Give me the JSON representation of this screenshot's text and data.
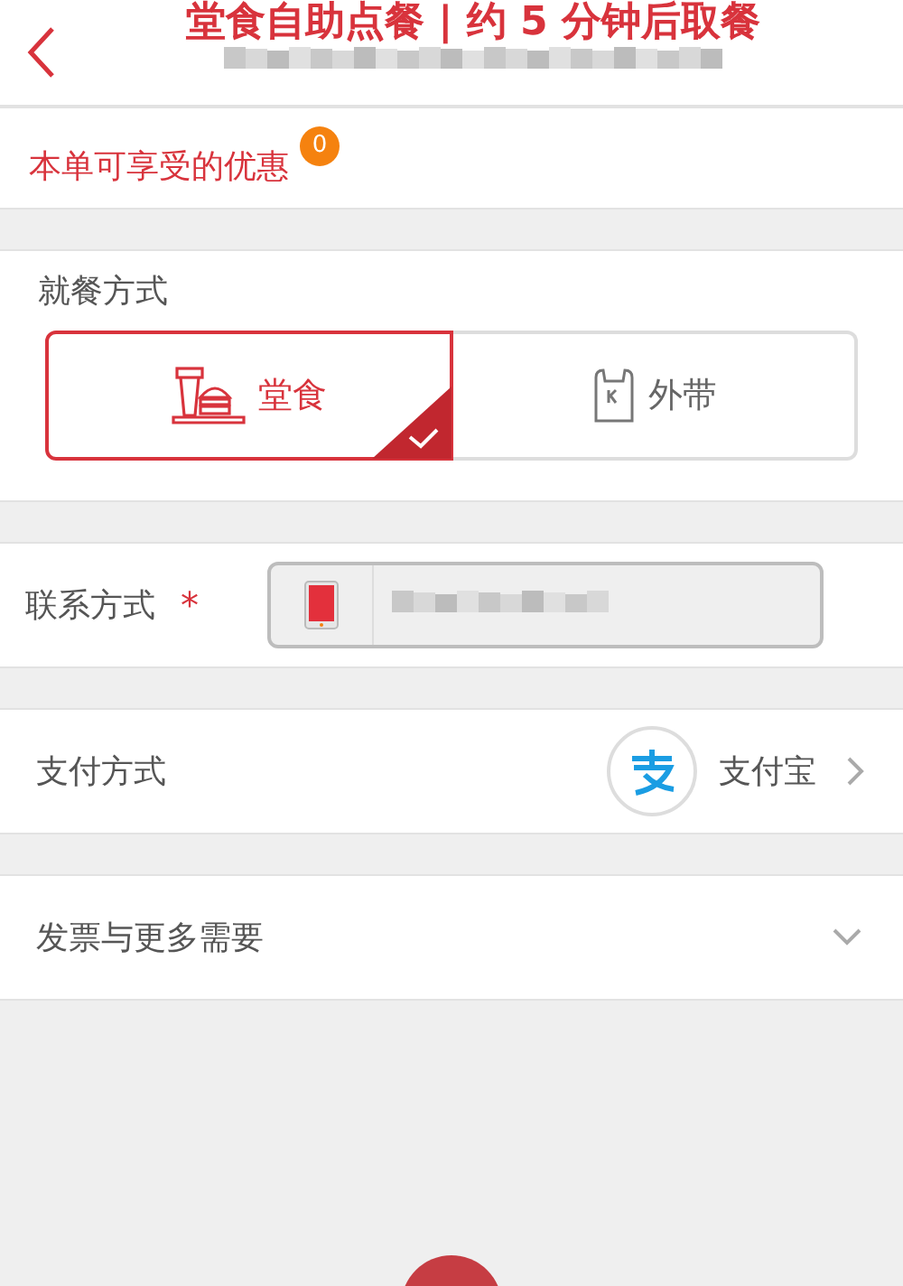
{
  "header": {
    "title": "堂食自助点餐 | 约 5 分钟后取餐"
  },
  "discount": {
    "label": "本单可享受的优惠",
    "count": "0"
  },
  "dining": {
    "label": "就餐方式",
    "options": [
      {
        "kind": "dine-in",
        "label": "堂食",
        "selected": true
      },
      {
        "kind": "takeaway",
        "label": "外带",
        "selected": false
      }
    ]
  },
  "contact": {
    "label": "联系方式",
    "required_mark": "*"
  },
  "payment": {
    "label": "支付方式",
    "method": "支付宝"
  },
  "invoice": {
    "label": "发票与更多需要",
    "expanded": false
  }
}
